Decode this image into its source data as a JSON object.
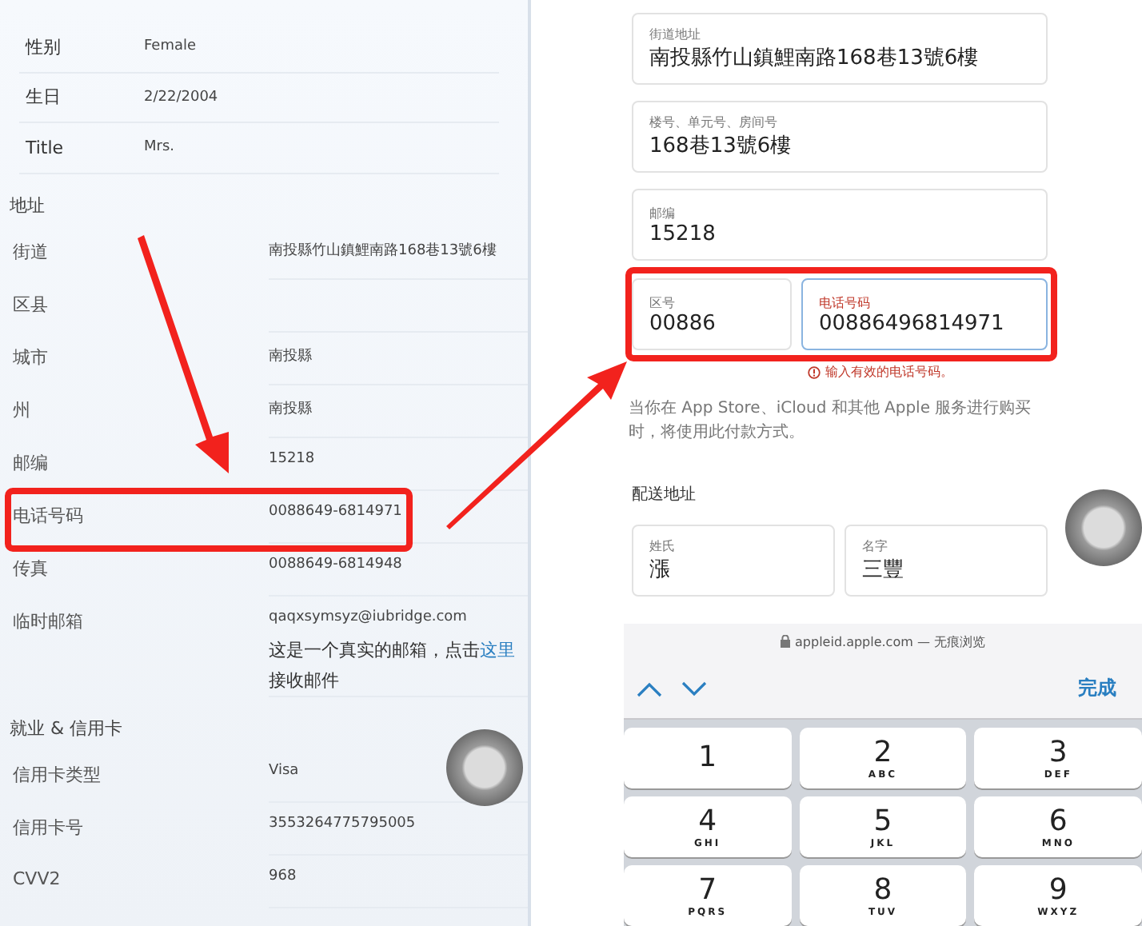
{
  "left_panel": {
    "personal_rows": [
      {
        "label": "性别",
        "value": "Female"
      },
      {
        "label": "生日",
        "value": "2/22/2004"
      },
      {
        "label": "Title",
        "value": "Mrs."
      }
    ],
    "sections": [
      {
        "title": "地址",
        "rows": [
          {
            "label": "街道",
            "value": "南投縣竹山鎮鯉南路168巷13號6樓",
            "highlighted": false
          },
          {
            "label": "区县",
            "highlighted": false
          },
          {
            "label": "城市",
            "value": "南投縣",
            "highlighted": false
          },
          {
            "label": "州",
            "value": "南投縣",
            "highlighted": false
          },
          {
            "label": "邮编",
            "value": "15218",
            "highlighted": false
          },
          {
            "label": "电话号码",
            "value": "0088649-6814971",
            "highlighted": true
          },
          {
            "label": "传真",
            "value": "0088649-6814948",
            "highlighted": false
          },
          {
            "label": "临时邮箱",
            "value": "qaqxsymsyz@iubridge.com",
            "highlighted": false,
            "note": {
              "before": "这是一个真实的邮箱，点击",
              "link": "这里",
              "after": "接收邮件"
            }
          }
        ]
      },
      {
        "title": "就业 & 信用卡",
        "rows": [
          {
            "label": "信用卡类型",
            "value": "Visa",
            "highlighted": false
          },
          {
            "label": "信用卡号",
            "value": "3553264775795005",
            "highlighted": false
          },
          {
            "label": "CVV2",
            "value": "968",
            "highlighted": false
          }
        ]
      }
    ]
  },
  "right_panel": {
    "fields": [
      {
        "label": "街道地址",
        "value": "南投縣竹山鎮鯉南路168巷13號6樓"
      },
      {
        "label": "楼号、单元号、房间号",
        "value": "168巷13號6樓"
      },
      {
        "label": "邮编",
        "value": "15218"
      }
    ],
    "phone_group": {
      "highlighted": true,
      "fields": [
        {
          "label": "区号",
          "value": "00886",
          "focused": false,
          "invalid": false
        },
        {
          "label": "电话号码",
          "value": "00886496814971",
          "focused": true,
          "invalid": true
        }
      ]
    },
    "error": "输入有效的电话号码。",
    "description": "当你在 App Store、iCloud 和其他 Apple 服务进行购买时，将使用此付款方式。",
    "shipping_title": "配送地址",
    "name_fields": [
      {
        "label": "姓氏",
        "value": "漲"
      },
      {
        "label": "名字",
        "value": "三豐"
      }
    ]
  },
  "keyboard": {
    "url": "appleid.apple.com — 无痕浏览",
    "done": "完成",
    "keys": [
      {
        "digit": "1"
      },
      {
        "digit": "2",
        "letters": "ABC"
      },
      {
        "digit": "3",
        "letters": "DEF"
      },
      {
        "digit": "4",
        "letters": "GHI"
      },
      {
        "digit": "5",
        "letters": "JKL"
      },
      {
        "digit": "6",
        "letters": "MNO"
      },
      {
        "digit": "7",
        "letters": "PQRS"
      },
      {
        "digit": "8",
        "letters": "TUV"
      },
      {
        "digit": "9",
        "letters": "WXYZ"
      }
    ]
  }
}
